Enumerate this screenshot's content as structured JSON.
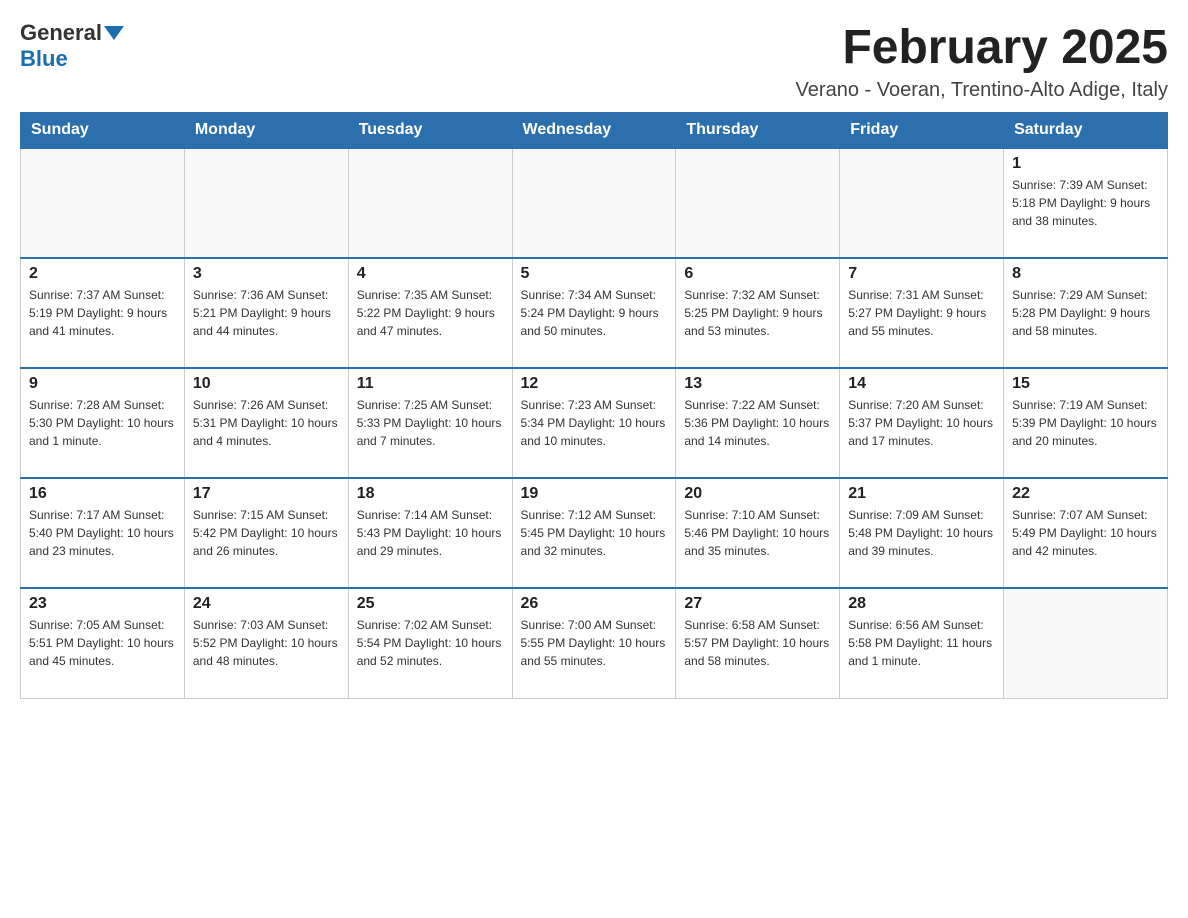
{
  "header": {
    "logo_general": "General",
    "logo_blue": "Blue",
    "month_title": "February 2025",
    "location": "Verano - Voeran, Trentino-Alto Adige, Italy"
  },
  "days_of_week": [
    "Sunday",
    "Monday",
    "Tuesday",
    "Wednesday",
    "Thursday",
    "Friday",
    "Saturday"
  ],
  "weeks": [
    [
      {
        "day": "",
        "info": ""
      },
      {
        "day": "",
        "info": ""
      },
      {
        "day": "",
        "info": ""
      },
      {
        "day": "",
        "info": ""
      },
      {
        "day": "",
        "info": ""
      },
      {
        "day": "",
        "info": ""
      },
      {
        "day": "1",
        "info": "Sunrise: 7:39 AM\nSunset: 5:18 PM\nDaylight: 9 hours and 38 minutes."
      }
    ],
    [
      {
        "day": "2",
        "info": "Sunrise: 7:37 AM\nSunset: 5:19 PM\nDaylight: 9 hours and 41 minutes."
      },
      {
        "day": "3",
        "info": "Sunrise: 7:36 AM\nSunset: 5:21 PM\nDaylight: 9 hours and 44 minutes."
      },
      {
        "day": "4",
        "info": "Sunrise: 7:35 AM\nSunset: 5:22 PM\nDaylight: 9 hours and 47 minutes."
      },
      {
        "day": "5",
        "info": "Sunrise: 7:34 AM\nSunset: 5:24 PM\nDaylight: 9 hours and 50 minutes."
      },
      {
        "day": "6",
        "info": "Sunrise: 7:32 AM\nSunset: 5:25 PM\nDaylight: 9 hours and 53 minutes."
      },
      {
        "day": "7",
        "info": "Sunrise: 7:31 AM\nSunset: 5:27 PM\nDaylight: 9 hours and 55 minutes."
      },
      {
        "day": "8",
        "info": "Sunrise: 7:29 AM\nSunset: 5:28 PM\nDaylight: 9 hours and 58 minutes."
      }
    ],
    [
      {
        "day": "9",
        "info": "Sunrise: 7:28 AM\nSunset: 5:30 PM\nDaylight: 10 hours and 1 minute."
      },
      {
        "day": "10",
        "info": "Sunrise: 7:26 AM\nSunset: 5:31 PM\nDaylight: 10 hours and 4 minutes."
      },
      {
        "day": "11",
        "info": "Sunrise: 7:25 AM\nSunset: 5:33 PM\nDaylight: 10 hours and 7 minutes."
      },
      {
        "day": "12",
        "info": "Sunrise: 7:23 AM\nSunset: 5:34 PM\nDaylight: 10 hours and 10 minutes."
      },
      {
        "day": "13",
        "info": "Sunrise: 7:22 AM\nSunset: 5:36 PM\nDaylight: 10 hours and 14 minutes."
      },
      {
        "day": "14",
        "info": "Sunrise: 7:20 AM\nSunset: 5:37 PM\nDaylight: 10 hours and 17 minutes."
      },
      {
        "day": "15",
        "info": "Sunrise: 7:19 AM\nSunset: 5:39 PM\nDaylight: 10 hours and 20 minutes."
      }
    ],
    [
      {
        "day": "16",
        "info": "Sunrise: 7:17 AM\nSunset: 5:40 PM\nDaylight: 10 hours and 23 minutes."
      },
      {
        "day": "17",
        "info": "Sunrise: 7:15 AM\nSunset: 5:42 PM\nDaylight: 10 hours and 26 minutes."
      },
      {
        "day": "18",
        "info": "Sunrise: 7:14 AM\nSunset: 5:43 PM\nDaylight: 10 hours and 29 minutes."
      },
      {
        "day": "19",
        "info": "Sunrise: 7:12 AM\nSunset: 5:45 PM\nDaylight: 10 hours and 32 minutes."
      },
      {
        "day": "20",
        "info": "Sunrise: 7:10 AM\nSunset: 5:46 PM\nDaylight: 10 hours and 35 minutes."
      },
      {
        "day": "21",
        "info": "Sunrise: 7:09 AM\nSunset: 5:48 PM\nDaylight: 10 hours and 39 minutes."
      },
      {
        "day": "22",
        "info": "Sunrise: 7:07 AM\nSunset: 5:49 PM\nDaylight: 10 hours and 42 minutes."
      }
    ],
    [
      {
        "day": "23",
        "info": "Sunrise: 7:05 AM\nSunset: 5:51 PM\nDaylight: 10 hours and 45 minutes."
      },
      {
        "day": "24",
        "info": "Sunrise: 7:03 AM\nSunset: 5:52 PM\nDaylight: 10 hours and 48 minutes."
      },
      {
        "day": "25",
        "info": "Sunrise: 7:02 AM\nSunset: 5:54 PM\nDaylight: 10 hours and 52 minutes."
      },
      {
        "day": "26",
        "info": "Sunrise: 7:00 AM\nSunset: 5:55 PM\nDaylight: 10 hours and 55 minutes."
      },
      {
        "day": "27",
        "info": "Sunrise: 6:58 AM\nSunset: 5:57 PM\nDaylight: 10 hours and 58 minutes."
      },
      {
        "day": "28",
        "info": "Sunrise: 6:56 AM\nSunset: 5:58 PM\nDaylight: 11 hours and 1 minute."
      },
      {
        "day": "",
        "info": ""
      }
    ]
  ]
}
